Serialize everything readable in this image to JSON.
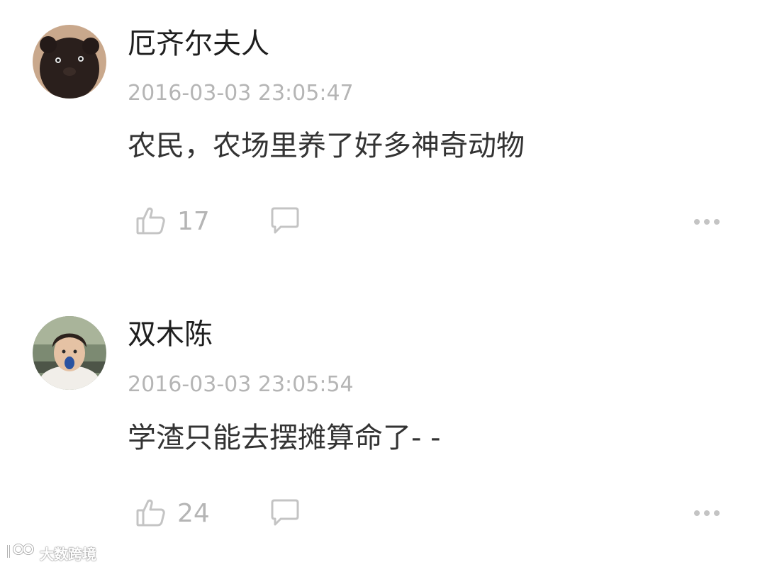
{
  "comments": [
    {
      "username": "厄齐尔夫人",
      "timestamp": "2016-03-03 23:05:47",
      "text": "农民，农场里养了好多神奇动物",
      "likes": "17",
      "avatar_icon": "dark-plush-bear-avatar"
    },
    {
      "username": "双木陈",
      "timestamp": "2016-03-03 23:05:54",
      "text": "学渣只能去摆摊算命了- -",
      "likes": "24",
      "avatar_icon": "boy-photo-avatar"
    }
  ],
  "icons": {
    "like": "thumbs-up-icon",
    "reply": "speech-bubble-icon",
    "more": "ellipsis-icon"
  },
  "watermark": {
    "text": "大数跨境"
  },
  "colors": {
    "username": "#1f1f1f",
    "timestamp": "#b5b5b5",
    "body": "#333333",
    "icon": "#c4c4c4"
  }
}
